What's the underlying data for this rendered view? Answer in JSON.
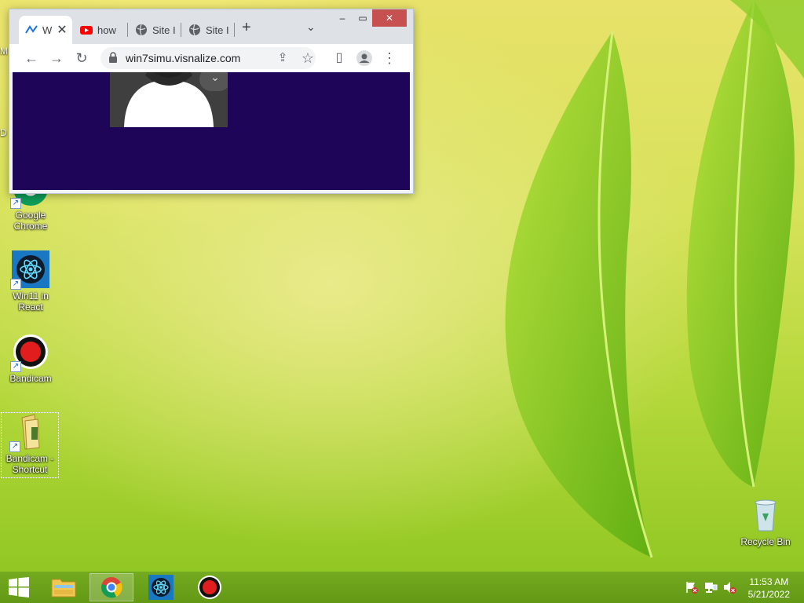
{
  "desktop": {
    "edge_labels": [
      "M",
      "D"
    ],
    "icons": [
      {
        "label_line1": "Google",
        "label_line2": "Chrome"
      },
      {
        "label_line1": "Win11 in",
        "label_line2": "React"
      },
      {
        "label_line1": "Bandicam",
        "label_line2": ""
      },
      {
        "label_line1": "Bandicam -",
        "label_line2": "Shortcut"
      }
    ],
    "recycle_bin": "Recycle Bin"
  },
  "browser": {
    "tabs": [
      {
        "title": "W",
        "favicon": "visnalize-icon",
        "active": true
      },
      {
        "title": "how",
        "favicon": "youtube-icon",
        "active": false
      },
      {
        "title": "Site I",
        "favicon": "globe-icon",
        "active": false
      },
      {
        "title": "Site I",
        "favicon": "globe-icon",
        "active": false
      }
    ],
    "url": "win7simu.visnalize.com",
    "content_bg": "#1e0558"
  },
  "taskbar": {
    "apps": [
      "file-explorer-icon",
      "chrome-icon",
      "react-icon",
      "bandicam-icon"
    ],
    "time": "11:53 AM",
    "date": "5/21/2022"
  },
  "colors": {
    "accent": "#72a820",
    "window_close": "#c75050"
  }
}
